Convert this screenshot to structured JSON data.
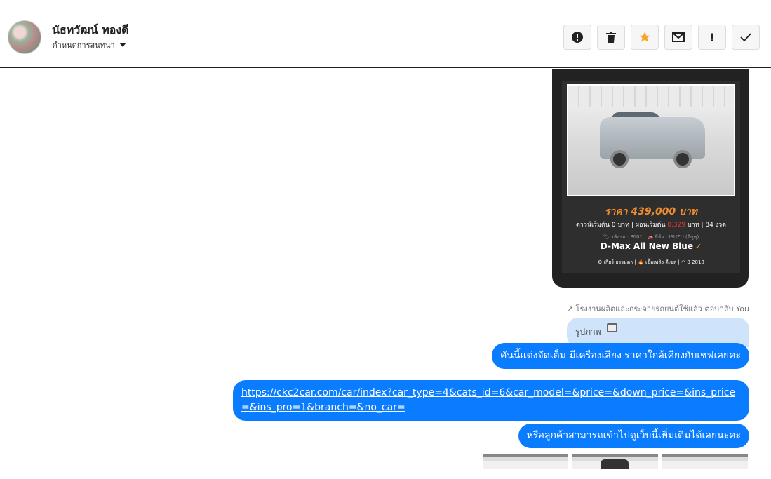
{
  "header": {
    "name": "นัธทวัฒน์ ทองดี",
    "subtitle": "กำหนดการสนทนา",
    "actions": [
      {
        "name": "report",
        "icon": "exclamation-circle-icon"
      },
      {
        "name": "delete",
        "icon": "trash-icon"
      },
      {
        "name": "star",
        "icon": "star-icon",
        "color": "#f5a623"
      },
      {
        "name": "mark-unread",
        "icon": "envelope-icon"
      },
      {
        "name": "important",
        "icon": "exclamation-icon",
        "glyph": "!"
      },
      {
        "name": "done",
        "icon": "check-icon"
      }
    ]
  },
  "card": {
    "price": "ราคา 439,000 บาท",
    "terms_prefix": "ดาวน์เริ่มต้น 0 บาท | ผ่อนเริ่มต้น ",
    "terms_amount": "8,329",
    "terms_suffix": " บาท | 84 งวด",
    "meta": "🏷 รหัสรถ : P001 | 🚗 ยี่ห้อ : ISUZU (อีซูซุ)",
    "model": "D-Max All New Blue",
    "specs": "⚙ เกียร์ ธรรมดา   |   🔥 เชื้อเพลิง ดีเซล   |   ◠ 0 2018"
  },
  "reply_note": "↗ โรงงานผลิตและกระจายรถยนต์ใช้แล้ว ตอบกลับ You",
  "quoted": {
    "label": "รูปภาพ"
  },
  "messages": {
    "m1": "คันนี้แต่งจัดเต็ม มีเครื่องเสียง ราคาใกล้เคียงกับเชฟเลยคะ",
    "link": "https://ckc2car.com/car/index?car_type=4&cats_id=6&car_model=&price=&down_price=&ins_price=&ins_pro=1&branch=&no_car=",
    "m3": "หรือลูกค้าสามารถเข้าไปดูเว็บนี้เพิ่มเติมได้เลยนะคะ"
  },
  "colors": {
    "accent": "#0a7cff",
    "price": "#f08c2e",
    "quoted_bg": "#cfe3fb"
  }
}
